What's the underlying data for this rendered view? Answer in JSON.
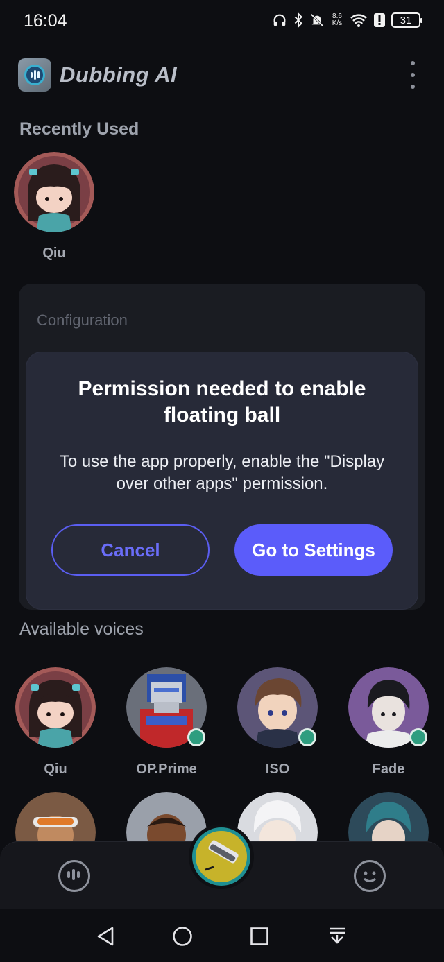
{
  "status_bar": {
    "time": "16:04",
    "net_speed_value": "8.6",
    "net_speed_unit": "K/s",
    "battery": "31"
  },
  "header": {
    "app_name": "Dubbing AI"
  },
  "recently_used": {
    "title": "Recently Used",
    "items": [
      {
        "name": "Qiu"
      }
    ]
  },
  "configuration": {
    "label": "Configuration"
  },
  "dialog": {
    "title": "Permission needed to enable floating ball",
    "body": "To use the app properly, enable the \"Display over other apps\" permission.",
    "cancel_label": "Cancel",
    "settings_label": "Go to Settings"
  },
  "voices": {
    "title": "Available voices",
    "items": [
      {
        "name": "Qiu",
        "badge": false
      },
      {
        "name": "OP.Prime",
        "badge": true
      },
      {
        "name": "ISO",
        "badge": true
      },
      {
        "name": "Fade",
        "badge": true
      }
    ]
  },
  "colors": {
    "background": "#0d0e12",
    "dialog": "#272a38",
    "accent": "#5b5cfa",
    "badge": "#2e9d7f"
  }
}
